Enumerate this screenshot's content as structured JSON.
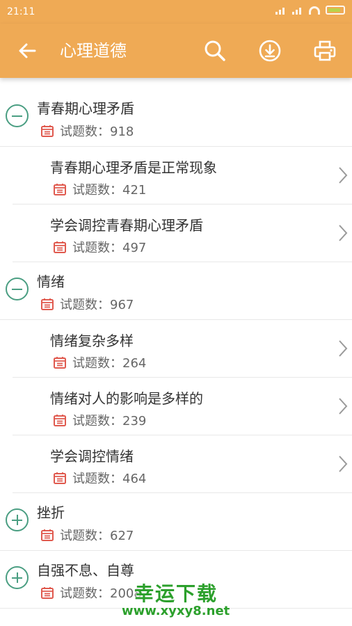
{
  "status_bar": {
    "time": "21:11",
    "battery": "60"
  },
  "toolbar": {
    "title": "心理道德",
    "icons": [
      "back-arrow-icon",
      "search-icon",
      "download-icon",
      "print-icon"
    ]
  },
  "groups": [
    {
      "title": "青春期心理矛盾",
      "count_label": "试题数：918",
      "expanded": true,
      "items": [
        {
          "title": "青春期心理矛盾是正常现象",
          "count_label": "试题数：421"
        },
        {
          "title": "学会调控青春期心理矛盾",
          "count_label": "试题数：497"
        }
      ]
    },
    {
      "title": "情绪",
      "count_label": "试题数：967",
      "expanded": true,
      "items": [
        {
          "title": "情绪复杂多样",
          "count_label": "试题数：264"
        },
        {
          "title": "情绪对人的影响是多样的",
          "count_label": "试题数：239"
        },
        {
          "title": "学会调控情绪",
          "count_label": "试题数：464"
        }
      ]
    },
    {
      "title": "挫折",
      "count_label": "试题数：627",
      "expanded": false,
      "items": []
    },
    {
      "title": "自强不息、自尊",
      "count_label": "试题数：2008",
      "expanded": false,
      "items": []
    }
  ],
  "watermark": {
    "line1": "幸运下载",
    "line2": "www.xyxy8.net"
  },
  "colors": {
    "header": "#efaa55",
    "toggle": "#4a9e82",
    "calendar": "#e05a4f"
  }
}
